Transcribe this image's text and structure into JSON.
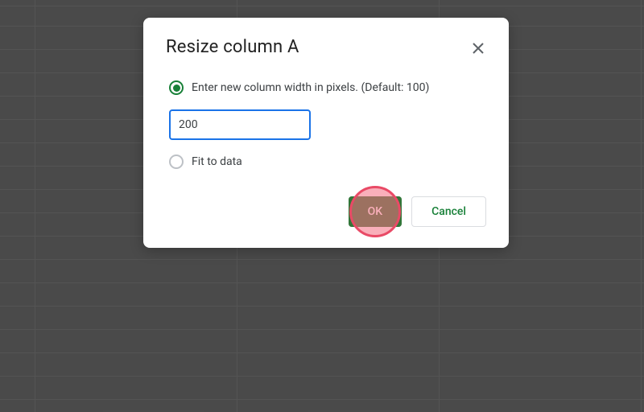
{
  "dialog": {
    "title": "Resize column A",
    "option_pixels_label": "Enter new column width in pixels. (Default: 100)",
    "width_value": "200",
    "option_fit_label": "Fit to data",
    "ok_label": "OK",
    "cancel_label": "Cancel"
  }
}
